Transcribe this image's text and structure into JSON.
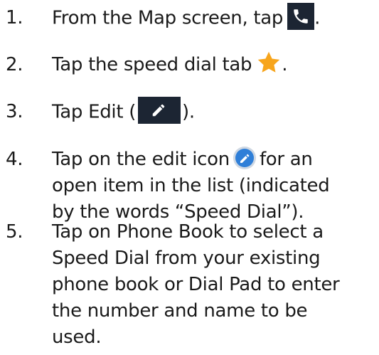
{
  "steps": [
    {
      "number": "1.",
      "text_before": "From the Map screen, tap",
      "icon": "phone-icon",
      "text_after": "."
    },
    {
      "number": "2.",
      "text_before": "Tap the speed dial tab",
      "icon": "star-icon",
      "text_after": "."
    },
    {
      "number": "3.",
      "text_before": "Tap Edit (",
      "icon": "pencil-icon",
      "text_after": ")."
    },
    {
      "number": "4.",
      "line1_before": "Tap on the edit icon",
      "icon": "edit-circle-icon",
      "line1_after": "for an",
      "line2": "open item in the list (indicated",
      "line3_before": "by the words “",
      "line3_em": "Speed Dial",
      "line3_after": "”)."
    },
    {
      "number": "5.",
      "lines": [
        "Tap on Phone Book to select a",
        "Speed Dial from your existing",
        "phone book or Dial Pad to enter",
        "the number and name to be",
        "used."
      ]
    }
  ],
  "colors": {
    "icon_background": "#1c2533",
    "star": "#f7a51c",
    "edit_circle": "#2f7fd8",
    "text": "#1a1a1a"
  }
}
